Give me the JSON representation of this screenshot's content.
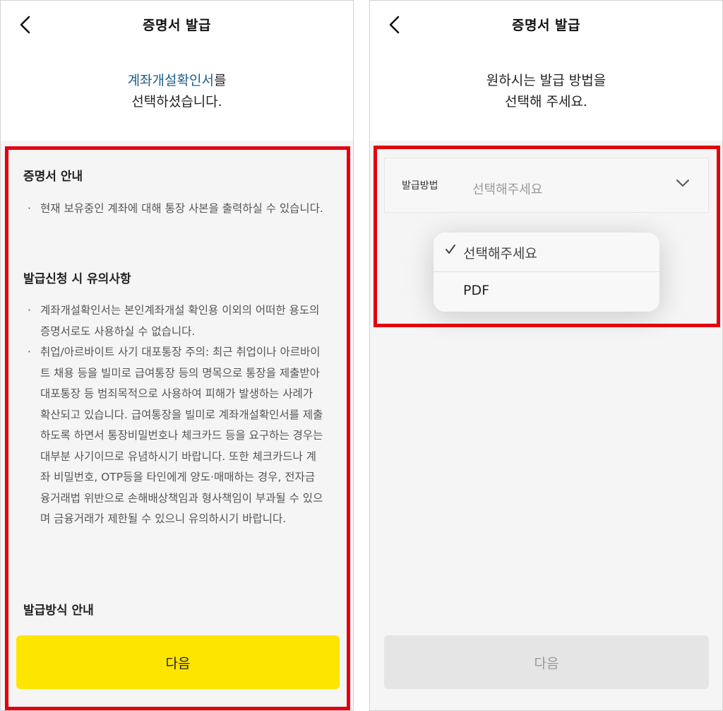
{
  "left": {
    "header_title": "증명서 발급",
    "intro_highlight": "계좌개설확인서",
    "intro_suffix": "를",
    "intro_line2": "선택하셨습니다.",
    "section1": {
      "title": "증명서 안내",
      "bullets": [
        "현재 보유중인 계좌에 대해 통장 사본을 출력하실 수 있습니다."
      ]
    },
    "section2": {
      "title": "발급신청 시 유의사항",
      "bullets": [
        "계좌개설확인서는 본인계좌개설 확인용 이외의 어떠한 용도의 증명서로도 사용하실 수 없습니다.",
        "취업/아르바이트 사기 대포통장 주의: 최근 취업이나 아르바이트 채용 등을 빌미로 급여통장 등의 명목으로 통장을 제출받아 대포통장 등 범죄목적으로 사용하여 피해가 발생하는 사례가 확산되고 있습니다. 급여통장을 빌미로 계좌개설확인서를 제출하도록 하면서 통장비밀번호나 체크카드 등을 요구하는 경우는 대부분 사기이므로 유념하시기 바랍니다. 또한 체크카드나 계좌 비밀번호, OTP등을 타인에게 양도·매매하는 경우, 전자금융거래법 위반으로 손해배상책임과 형사책임이 부과될 수 있으며 금융거래가 제한될 수 있으니 유의하시기 바랍니다."
      ]
    },
    "section3": {
      "title": "발급방식 안내"
    },
    "next_label": "다음"
  },
  "right": {
    "header_title": "증명서 발급",
    "intro_line1": "원하시는 발급 방법을",
    "intro_line2": "선택해 주세요.",
    "method_label": "발급방법",
    "method_value": "선택해주세요",
    "options": [
      {
        "label": "선택해주세요",
        "selected": true
      },
      {
        "label": "PDF",
        "selected": false
      }
    ],
    "next_label": "다음"
  },
  "colors": {
    "highlight_blue": "#1f5f8b",
    "yellow": "#fee500",
    "red_outline": "#e3000f",
    "disabled_gray": "#e5e5e5"
  }
}
